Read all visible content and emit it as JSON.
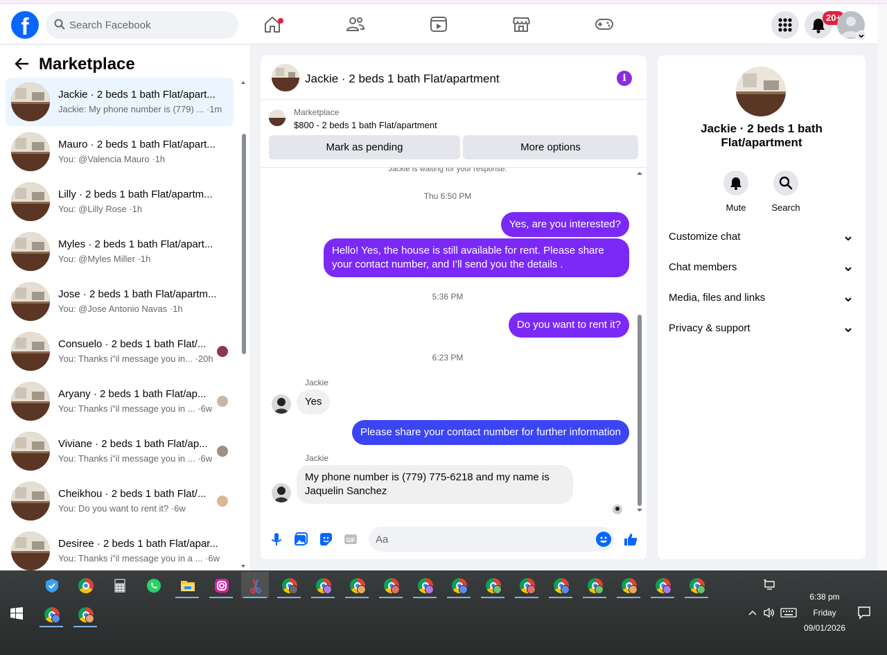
{
  "topbar": {
    "search_placeholder": "Search Facebook",
    "notifications_badge": "20+",
    "logo_letter": "f"
  },
  "left": {
    "title": "Marketplace",
    "conversations": [
      {
        "name": "Jackie · 2 beds 1 bath Flat/apart...",
        "preview": "Jackie: My phone number is (779) ... ·1m",
        "active": true
      },
      {
        "name": "Mauro · 2 beds 1 bath Flat/apart...",
        "preview": "You: @Valencia Mauro ·1h"
      },
      {
        "name": "Lilly · 2 beds 1 bath Flat/apartm...",
        "preview": "You: @Lilly Rose ·1h"
      },
      {
        "name": "Myles · 2 beds 1 bath Flat/apart...",
        "preview": "You: @Myles Miller ·1h"
      },
      {
        "name": "Jose · 2 beds 1 bath Flat/apartm...",
        "preview": "You: @Jose Antonio Navas ·1h"
      },
      {
        "name": "Consuelo · 2 beds 1 bath Flat/...",
        "preview": "You: Thanks i\"il message you in... ·20h"
      },
      {
        "name": "Aryany · 2 beds 1 bath Flat/ap...",
        "preview": "You: Thanks i\"il message you in ... ·6w"
      },
      {
        "name": "Viviane · 2 beds 1 bath Flat/ap...",
        "preview": "You: Thanks i\"il message you in ... ·6w"
      },
      {
        "name": "Cheikhou · 2 beds 1 bath Flat/...",
        "preview": "You: Do you want to rent it? ·6w"
      },
      {
        "name": "Desiree · 2 beds 1 bath Flat/apar...",
        "preview": "You: Thanks i\"il message you in a ... ·6w"
      }
    ]
  },
  "chat": {
    "title": "Jackie · 2 beds 1 bath Flat/apartment",
    "marketplace_label": "Marketplace",
    "listing": "$800 - 2 beds 1 bath Flat/apartment",
    "mark_pending": "Mark as pending",
    "more_options": "More options",
    "waiting": "Jackie is waiting for your response.",
    "messages": {
      "t1": "Thu 6:50 PM",
      "m1": "Yes, are you interested?",
      "m2": "Hello! Yes, the house is still available for rent. Please share your contact number, and I’ll send you the details .",
      "t2": "5:36 PM",
      "m3": "Do you want to rent it?",
      "t3": "6:23 PM",
      "s1": "Jackie",
      "m4": "Yes",
      "m5": "Please share your contact number for further information",
      "s2": "Jackie",
      "m6": "My phone number is (779) 775-6218 and my name is Jaquelin Sanchez"
    },
    "composer_placeholder": "Aa"
  },
  "right": {
    "title": "Jackie · 2 beds 1 bath Flat/apartment",
    "mute": "Mute",
    "search": "Search",
    "sections": [
      "Customize chat",
      "Chat members",
      "Media, files and links",
      "Privacy & support"
    ]
  },
  "taskbar": {
    "time": "6:38 pm",
    "day": "Friday",
    "date": "09/01/2026"
  },
  "colors": {
    "accent": "#0866ff",
    "outgoing": "#7b29f6",
    "outgoing_blue": "#3b45f3",
    "info": "#8a2be2"
  }
}
